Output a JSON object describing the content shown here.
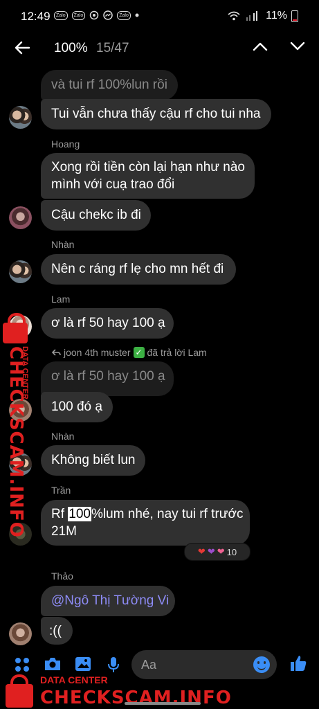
{
  "status_bar": {
    "time": "12:49",
    "app_icons": [
      "Zalo",
      "Zalo",
      "Zalo"
    ],
    "battery": "11%"
  },
  "header": {
    "zoom": "100%",
    "match_counter": "15/47"
  },
  "messages": [
    {
      "sender": "",
      "text": "và tui rf 100%lun rồi",
      "style": "quoted"
    },
    {
      "sender": "",
      "text": "Tui vẫn chưa thấy cậu rf cho tui nha"
    },
    {
      "sender": "Hoang",
      "text_line1": "Xong rồi tiền còn lại hạn như nào",
      "text_line2": "mình với cuạ trao đổi"
    },
    {
      "sender": "",
      "text": "Cậu chekc ib đi"
    },
    {
      "sender": "Nhàn",
      "text": "Nên c ráng rf lẹ cho mn hết đi"
    },
    {
      "sender": "Lam",
      "text": "ơ là rf 50 hay 100 ạ"
    },
    {
      "reply_note_name": "joon 4th muster",
      "reply_note_suffix": "đã trả lời Lam",
      "quoted": "ơ là rf 50 hay 100 ạ",
      "text": "100 đó ạ"
    },
    {
      "sender": "Nhàn",
      "text": "Không biết lun"
    },
    {
      "sender": "Trần",
      "text_pre": "Rf ",
      "text_hl": "100",
      "text_post": "%lum nhé, nay tui rf trước",
      "text_line2": "21M",
      "reaction_count": "10"
    },
    {
      "sender": "Thảo",
      "mention": "@Ngô Thị Tường Vi",
      "text": ":(("
    }
  ],
  "composer": {
    "placeholder": "Aa"
  },
  "watermark": {
    "brand": "CHECKSCAM.INFO",
    "tagline": "DATA CENTER"
  },
  "colors": {
    "accent": "#3a8df5",
    "bubble": "#303030",
    "mention": "#8e8cf7",
    "watermark": "#e02020"
  }
}
